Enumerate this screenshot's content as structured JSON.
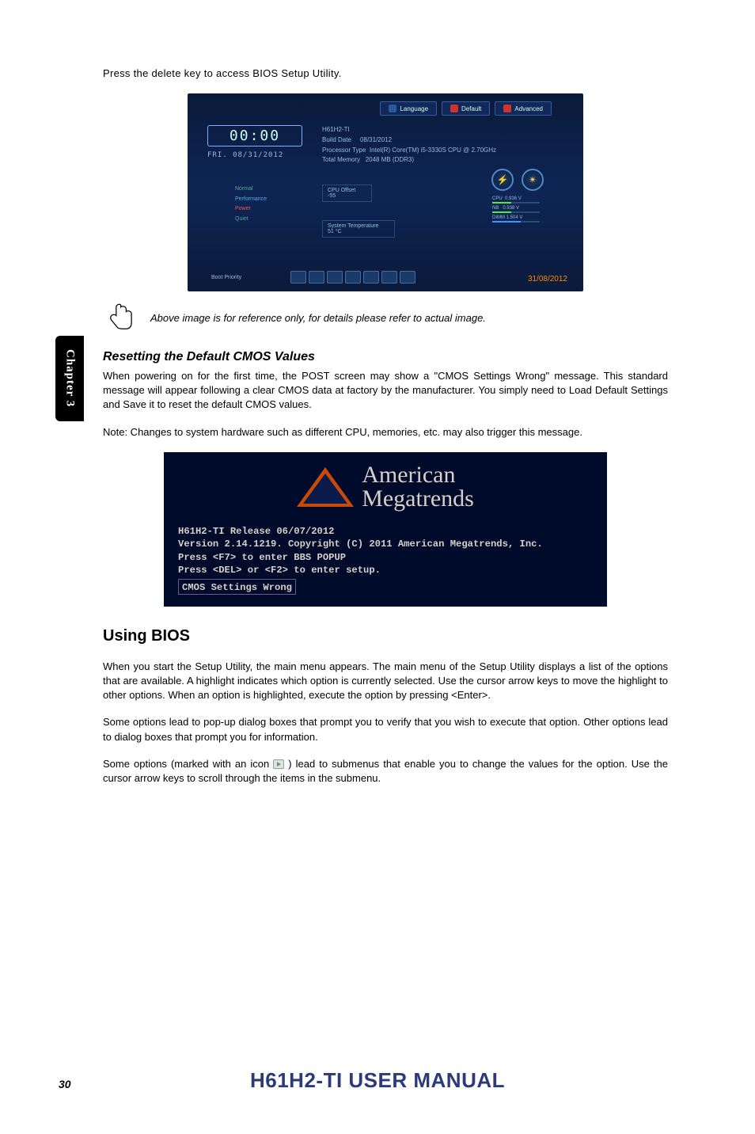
{
  "chapter_tab": "Chapter 3",
  "intro": "Press the delete key to access BIOS Setup Utility.",
  "bios": {
    "tabs": {
      "language": "Language",
      "default": "Default",
      "advanced": "Advanced"
    },
    "clock": "00:00",
    "date": "FRI. 08/31/2012",
    "info": {
      "model_label": "H61H2-TI",
      "build_date_label": "Build Date",
      "build_date": "08/31/2012",
      "processor_label": "Processor Type",
      "processor": "Intel(R) Core(TM) i5-3330S CPU @ 2.70GHz",
      "memory_label": "Total Memory",
      "memory": "2048 MB (DDR3)"
    },
    "profiles": {
      "normal": "Normal",
      "performance": "Performance",
      "power": "Power",
      "quiet": "Quiet"
    },
    "cpu_offset": {
      "label": "CPU Offset",
      "value": "-55"
    },
    "sys_temp": {
      "label": "System Temperature",
      "value": "51 °C"
    },
    "bars": {
      "cpu": {
        "label": "CPU",
        "value": "0.936 V"
      },
      "nb": {
        "label": "NB",
        "value": "0.938 V"
      },
      "dimm": {
        "label": "DIMM",
        "value": "1.504 V"
      }
    },
    "boot_priority": "Boot Priority",
    "corner_date": "31/08/2012"
  },
  "note": "Above image is for reference only, for details please refer to actual image.",
  "reset_section": {
    "heading": "Resetting the Default CMOS Values",
    "para1": "When powering on for the first time, the POST screen may show a \"CMOS Settings Wrong\" message. This standard message will appear following a clear CMOS data at factory by the manufacturer. You simply need to Load Default Settings and Save it to reset the default CMOS values.",
    "para2": "Note: Changes to system hardware such as different CPU, memories, etc. may also trigger this message."
  },
  "ami": {
    "logo_line1": "American",
    "logo_line2": "Megatrends",
    "line1": "H61H2-TI Release  06/07/2012",
    "line2": "Version 2.14.1219. Copyright (C) 2011 American Megatrends, Inc.",
    "line3": "Press <F7> to enter BBS POPUP",
    "line4": "Press <DEL> or <F2> to enter setup.",
    "cmos": "CMOS Settings Wrong"
  },
  "using_bios": {
    "heading": "Using BIOS",
    "para1": "When you start the Setup Utility, the main menu appears. The main menu of the Setup Utility displays a list of the options that are available. A highlight indicates which option is currently selected. Use the cursor arrow keys to move the highlight to other options. When an option is highlighted, execute the option by pressing <Enter>.",
    "para2": "Some options lead to pop-up dialog boxes that prompt you to verify that you wish to execute that option. Other options lead to dialog boxes that prompt you for information.",
    "para3_a": "Some options (marked with an icon ",
    "para3_b": " ) lead to submenus that enable you to change the values for the option. Use the cursor arrow keys to scroll through the items in the submenu."
  },
  "footer": "H61H2-TI USER MANUAL",
  "page_number": "30"
}
